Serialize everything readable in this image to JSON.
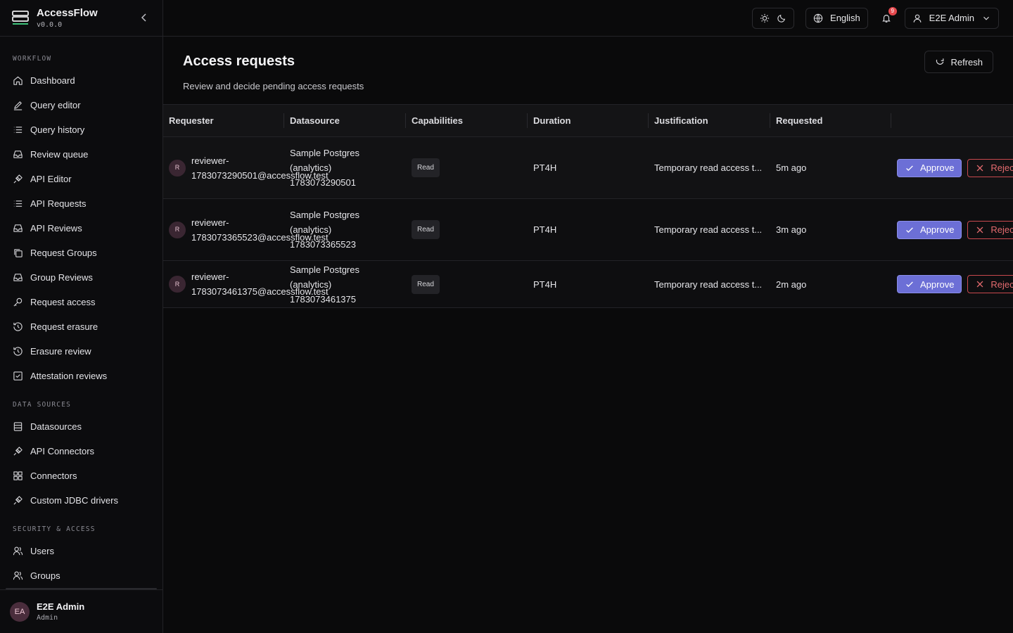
{
  "app": {
    "name": "AccessFlow",
    "version": "v0.0.0"
  },
  "sidebar": {
    "sections": [
      {
        "title": "WORKFLOW",
        "items": [
          {
            "label": "Dashboard",
            "icon": "home-icon"
          },
          {
            "label": "Query editor",
            "icon": "pencil-icon"
          },
          {
            "label": "Query history",
            "icon": "list-icon"
          },
          {
            "label": "Review queue",
            "icon": "inbox-icon"
          },
          {
            "label": "API Editor",
            "icon": "plug-icon"
          },
          {
            "label": "API Requests",
            "icon": "list-icon"
          },
          {
            "label": "API Reviews",
            "icon": "inbox-icon"
          },
          {
            "label": "Request Groups",
            "icon": "copy-icon"
          },
          {
            "label": "Group Reviews",
            "icon": "inbox-icon"
          },
          {
            "label": "Request access",
            "icon": "key-icon"
          },
          {
            "label": "Request erasure",
            "icon": "history-icon"
          },
          {
            "label": "Erasure review",
            "icon": "history-icon"
          },
          {
            "label": "Attestation reviews",
            "icon": "checkbox-icon"
          }
        ]
      },
      {
        "title": "DATA SOURCES",
        "items": [
          {
            "label": "Datasources",
            "icon": "database-icon"
          },
          {
            "label": "API Connectors",
            "icon": "plug-icon"
          },
          {
            "label": "Connectors",
            "icon": "grid-icon"
          },
          {
            "label": "Custom JDBC drivers",
            "icon": "plug-icon"
          }
        ]
      },
      {
        "title": "SECURITY & ACCESS",
        "items": [
          {
            "label": "Users",
            "icon": "users-icon"
          },
          {
            "label": "Groups",
            "icon": "users-icon"
          }
        ]
      }
    ],
    "footer": {
      "initials": "EA",
      "name": "E2E Admin",
      "role": "Admin"
    }
  },
  "topbar": {
    "language": "English",
    "notifications": "9",
    "user": "E2E Admin"
  },
  "page": {
    "title": "Access requests",
    "subtitle": "Review and decide pending access requests",
    "refresh_label": "Refresh"
  },
  "table": {
    "columns": [
      "Requester",
      "Datasource",
      "Capabilities",
      "Duration",
      "Justification",
      "Requested",
      ""
    ],
    "rows": [
      {
        "initial": "R",
        "requester_1": "reviewer-",
        "requester_2": "1783073290501@accessflow.test",
        "datasource": "Sample Postgres (analytics) 1783073290501",
        "capability": "Read",
        "duration": "PT4H",
        "justification": "Temporary read access t...",
        "requested": "5m ago"
      },
      {
        "initial": "R",
        "requester_1": "reviewer-",
        "requester_2": "1783073365523@accessflow.test",
        "datasource": "Sample Postgres (analytics) 1783073365523",
        "capability": "Read",
        "duration": "PT4H",
        "justification": "Temporary read access t...",
        "requested": "3m ago"
      },
      {
        "initial": "R",
        "requester_1": "reviewer-",
        "requester_2": "1783073461375@accessflow.test",
        "datasource": "Sample Postgres (analytics) 1783073461375",
        "capability": "Read",
        "duration": "PT4H",
        "justification": "Temporary read access t...",
        "requested": "2m ago"
      }
    ],
    "approve_label": "Approve",
    "reject_label": "Reject"
  }
}
